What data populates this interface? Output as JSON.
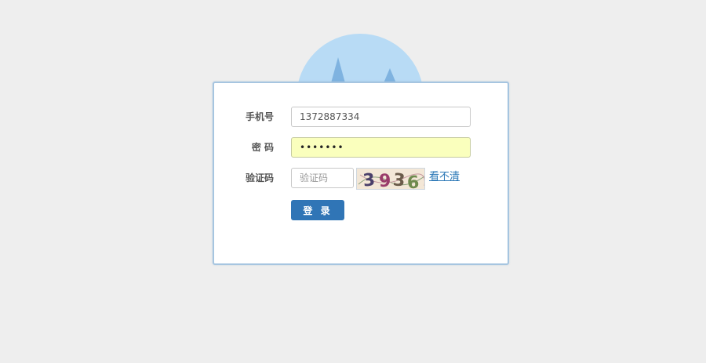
{
  "mascot": {
    "icon": "cat-ears-icon",
    "color": "#b8dbf5",
    "ear_color": "#7fb3e0"
  },
  "form": {
    "phone": {
      "label": "手机号",
      "value": "1372887334"
    },
    "password": {
      "label": "密 码",
      "value": "•••••••"
    },
    "captcha": {
      "label": "验证码",
      "placeholder": "验证码",
      "image_text": "3936",
      "refresh_label": "看不清"
    },
    "submit_label": "登 录"
  },
  "colors": {
    "background": "#eeeeee",
    "box_border": "#a6c5e0",
    "primary": "#3075b6",
    "autofill": "#faffbd",
    "link": "#2a77b6"
  }
}
